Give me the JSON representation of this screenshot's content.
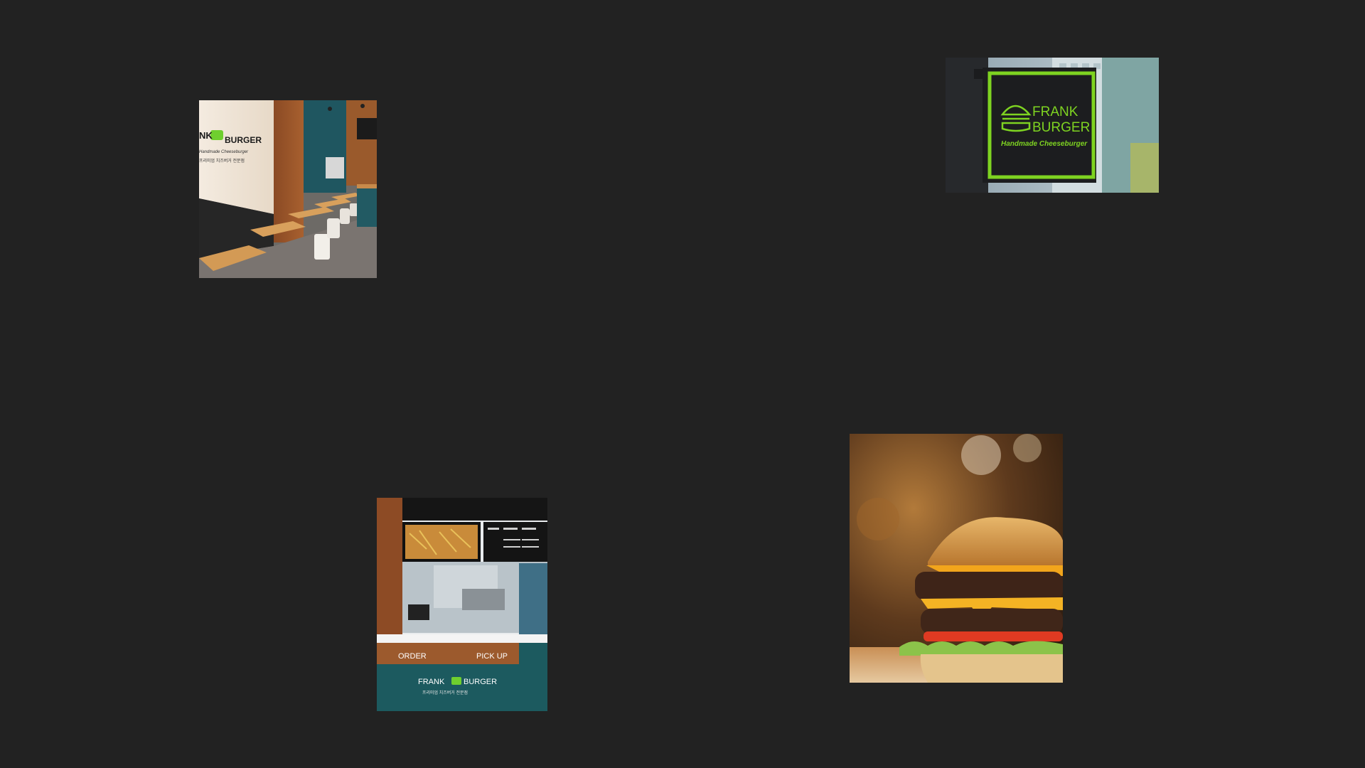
{
  "gallery": {
    "background": "#222222",
    "tiles": [
      {
        "name": "restaurant-interior",
        "wall_logo": {
          "line1": "NK",
          "line2": "BURGER",
          "tagline": "Handmade Cheeseburger",
          "korean": "프리미엄 치즈버거 전문점"
        }
      },
      {
        "name": "frank-burger-sign",
        "sign": {
          "line1": "FRANK",
          "line2": "BURGER",
          "tagline": "Handmade Cheeseburger",
          "accent": "#7ed321"
        }
      },
      {
        "name": "order-counter",
        "counter": {
          "order": "ORDER",
          "pickup": "PICK UP",
          "brand1": "FRANK",
          "brand2": "BURGER",
          "korean": "프리미엄 치즈버거 전문점"
        }
      },
      {
        "name": "cheeseburger-closeup"
      }
    ]
  }
}
